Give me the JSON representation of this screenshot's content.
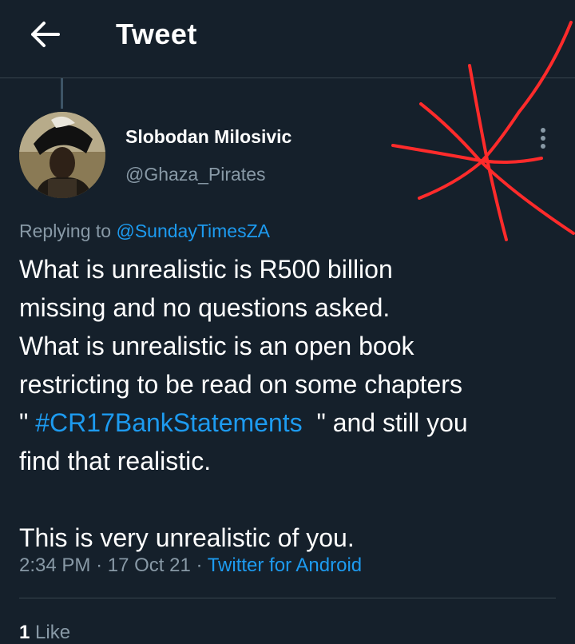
{
  "header": {
    "title": "Tweet",
    "back_icon": "arrow-left-icon"
  },
  "tweet": {
    "author_name": "Slobodan Milosivic",
    "author_handle": "@Ghaza_Pirates",
    "replying_prefix": "Replying to",
    "replying_to": "@SundayTimesZA",
    "text_line1": "What is unrealistic is R500 billion",
    "text_line2": "missing and no questions asked.",
    "text_line3": "What is unrealistic is an open book",
    "text_line4": "restricting to be read on some chapters",
    "text_line5_pre": "\" ",
    "hashtag": "#CR17BankStatements",
    "text_line5_post": "  \" and still you",
    "text_line6": "find that realistic.",
    "text_line7": "This is very unrealistic of you.",
    "time": "2:34 PM",
    "date": "17 Oct 21",
    "separator": "·",
    "source": "Twitter for Android",
    "likes_count": "1",
    "likes_label": "Like",
    "more_icon": "more-vertical-icon"
  },
  "colors": {
    "background": "#15202b",
    "link": "#1d9bf0",
    "secondary": "#8899a6",
    "annotation": "#ff2b2b"
  }
}
